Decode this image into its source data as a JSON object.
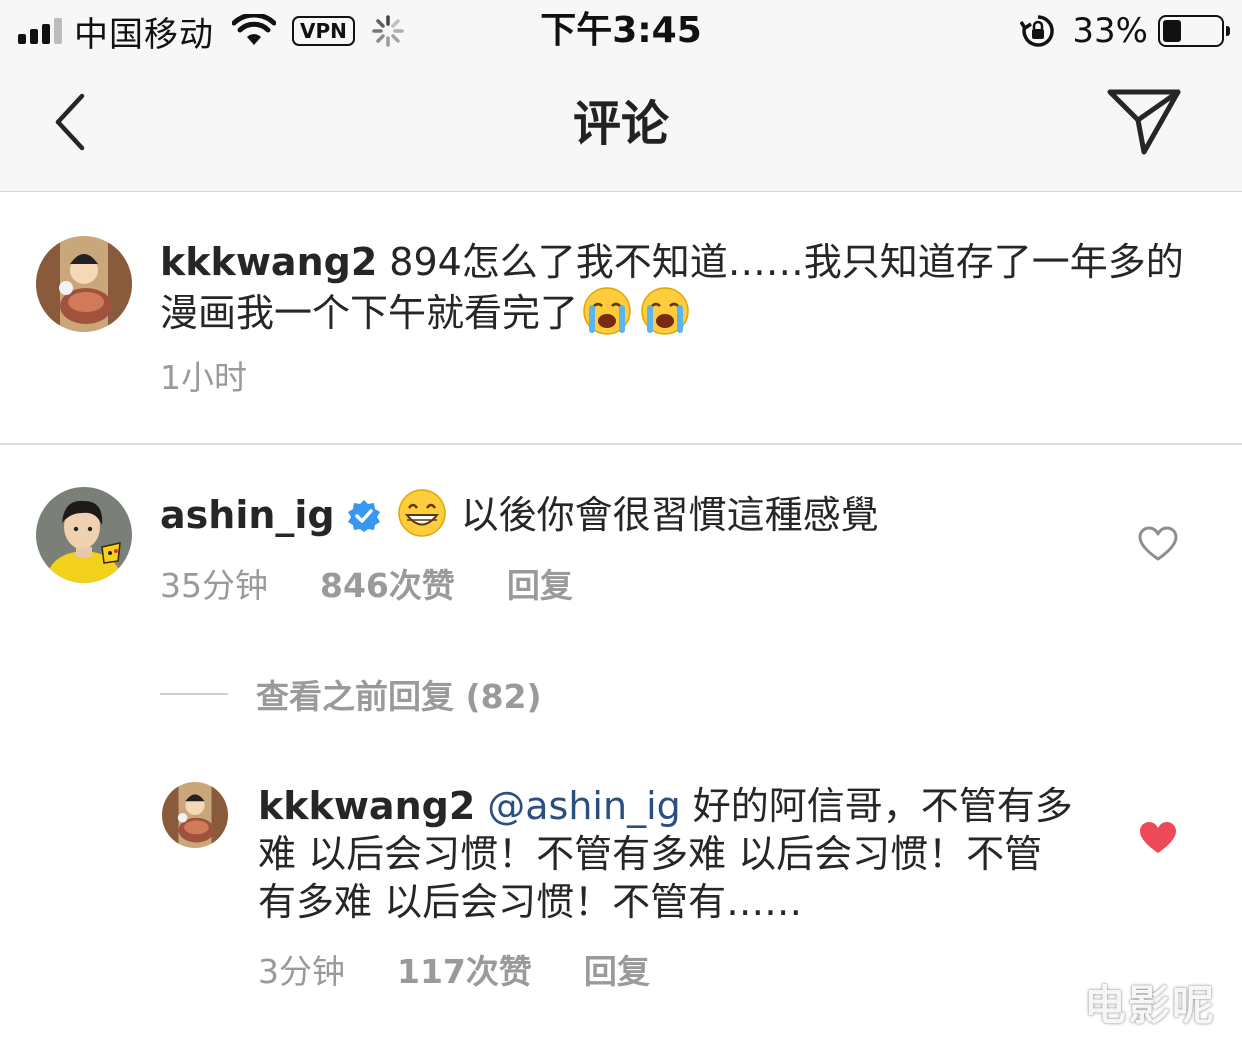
{
  "status_bar": {
    "carrier": "中国移动",
    "vpn": "VPN",
    "time": "下午3:45",
    "battery_percent": "33%",
    "battery_level": 0.33
  },
  "nav": {
    "title": "评论",
    "back_icon": "chevron-left-icon",
    "send_icon": "paper-plane-icon"
  },
  "comments": [
    {
      "username": "kkkwang2",
      "text_before_emoji": "894怎么了我不知道……我只知道存了一年多的漫画我一个下午就看完了",
      "emojis": [
        "crying-face-emoji",
        "crying-face-emoji"
      ],
      "time": "1小时"
    },
    {
      "username": "ashin_ig",
      "verified": true,
      "emoji": "grinning-face-emoji",
      "text": "以後你會很習慣這種感覺",
      "time": "35分钟",
      "likes": "846次赞",
      "reply": "回复",
      "liked": false
    }
  ],
  "view_previous_replies": "查看之前回复 (82)",
  "reply": {
    "username": "kkkwang2",
    "mention": "@ashin_ig",
    "text": "好的阿信哥，不管有多难 以后会习惯！不管有多难 以后会习惯！不管有多难 以后会习惯！不管有……",
    "time": "3分钟",
    "likes": "117次赞",
    "reply": "回复",
    "liked": true
  },
  "watermark": "电影呢",
  "colors": {
    "mention": "#2b4f7e",
    "liked_heart": "#ed4956",
    "verified": "#3897f0",
    "meta_gray": "#9a9a9a"
  }
}
